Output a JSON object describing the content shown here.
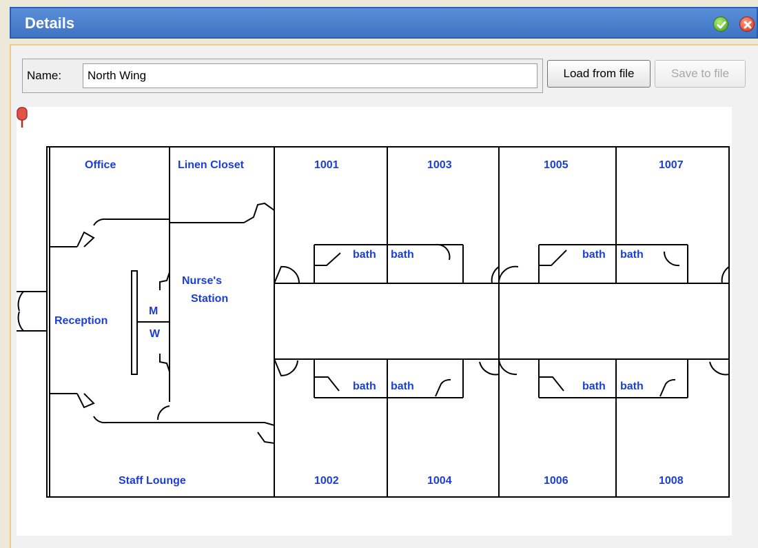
{
  "window": {
    "title": "Details",
    "ok_icon": "check-circle-icon",
    "close_icon": "x-circle-icon"
  },
  "name_field": {
    "label": "Name:",
    "value": "North Wing"
  },
  "buttons": {
    "load": "Load from file",
    "save": "Save to file"
  },
  "floorplan": {
    "rooms": {
      "office": "Office",
      "linen_closet": "Linen Closet",
      "nurses_station_1": "Nurse's",
      "nurses_station_2": "Station",
      "reception": "Reception",
      "m": "M",
      "w": "W",
      "staff_lounge": "Staff Lounge",
      "r1001": "1001",
      "r1003": "1003",
      "r1005": "1005",
      "r1007": "1007",
      "r1002": "1002",
      "r1004": "1004",
      "r1006": "1006",
      "r1008": "1008",
      "bath": "bath"
    },
    "label_color": "#1a3ed8",
    "marker_color": "#e0524a"
  }
}
